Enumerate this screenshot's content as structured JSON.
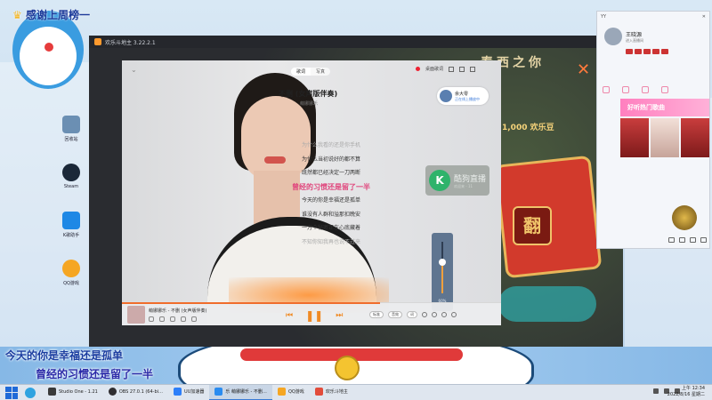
{
  "overlay": {
    "top_line1": "感谢上周榜一",
    "top_line2": "",
    "bottom_line1": "今天的你是幸福还是孤单",
    "bottom_line2": "曾经的习惯还是留了一半"
  },
  "desktop_icons": [
    {
      "label": "回收站",
      "color": "#6b8fb3"
    },
    {
      "label": "Steam",
      "color": "#1b2838"
    },
    {
      "label": "K歌助手",
      "color": "#1e88e5"
    },
    {
      "label": "QQ游戏",
      "color": "#f5a623"
    }
  ],
  "game_window": {
    "title": "欢乐斗地主 3.22.2.1",
    "header_text": "春西之你",
    "coins": "1,000 欢乐豆",
    "card_char": "翻"
  },
  "player": {
    "tabs": [
      "歌词",
      "写真"
    ],
    "top_right_label": "桌面歌词",
    "song_title": "不删 (女声版伴奏)",
    "song_artist": "萌娜娜乐",
    "lyrics": [
      "为什么我看的还是你手机",
      "为什么当初说好的都不算",
      "既然都已经决定一刀两断",
      "曾经的习惯还是留了一半",
      "今天的你是幸福还是孤单",
      "谁没有人群和溢那扣晚安",
      "一万个秘密正在心底藏着",
      "不知你知我再也说不过来"
    ],
    "current_lyric_index": 3,
    "user_card": {
      "name": "余大零",
      "sub": "正在线上播放中"
    },
    "volume": {
      "label": "60%",
      "level": 0.6
    },
    "bottom": {
      "song": "萌娜娜乐 - 不删 (女声版伴奏)",
      "chip1": "标准",
      "chip2": "音效",
      "chip3": "词",
      "progress": 0.68
    }
  },
  "kugou": {
    "text": "酷狗直播",
    "sub": "欢迎来 - 11"
  },
  "chat": {
    "title": "YY",
    "user": "王晓源",
    "sub": "进入直播间",
    "banner": "好听热门歌曲"
  },
  "taskbar": {
    "items": [
      {
        "label": "Studio One - 1.21",
        "color": "#3a3a3a",
        "active": false
      },
      {
        "label": "OBS 27.0.1 (64-bi…",
        "color": "#302e31",
        "active": false
      },
      {
        "label": "UU加速器",
        "color": "#2d7ff9",
        "active": false
      },
      {
        "label": "乐 萌娜娜乐 - 不删…",
        "color": "#2a8cf0",
        "active": true
      },
      {
        "label": "QQ游戏",
        "color": "#f5a623",
        "active": false
      },
      {
        "label": "欢乐斗地主",
        "color": "#e24c3b",
        "active": false
      }
    ],
    "time": "上午 12:34",
    "date": "2022/8/16 星期二"
  }
}
